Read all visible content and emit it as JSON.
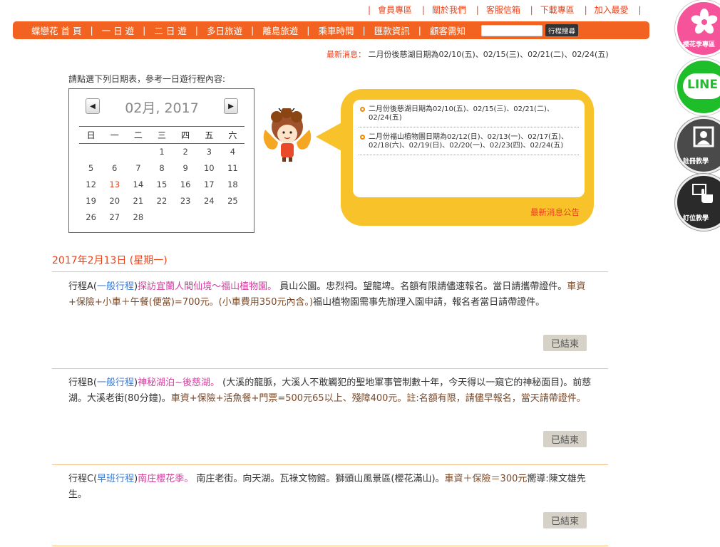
{
  "toplinks": [
    "會員專區",
    "關於我們",
    "客服信箱",
    "下載專區",
    "加入最愛"
  ],
  "nav": {
    "items": [
      "蝶戀花 首 頁",
      "一 日 遊",
      "二 日 遊",
      "多日旅遊",
      "離島旅遊",
      "乘車時間",
      "匯款資訊",
      "顧客需知"
    ],
    "search_button": "行程搜尋"
  },
  "news_line": {
    "label": "最新消息：",
    "text": "二月份後慈湖日期為02/10(五)、02/15(三)、02/21(二)、02/24(五)"
  },
  "instruction": "請點選下列日期表，參考一日遊行程內容:",
  "calendar": {
    "title": "02月, 2017",
    "prev": "◀",
    "next": "▶",
    "weekdays": [
      "日",
      "一",
      "二",
      "三",
      "四",
      "五",
      "六"
    ],
    "weeks": [
      [
        "",
        "",
        "",
        "1",
        "2",
        "3",
        "4"
      ],
      [
        "5",
        "6",
        "7",
        "8",
        "9",
        "10",
        "11"
      ],
      [
        "12",
        "13",
        "14",
        "15",
        "16",
        "17",
        "18"
      ],
      [
        "19",
        "20",
        "21",
        "22",
        "23",
        "24",
        "25"
      ],
      [
        "26",
        "27",
        "28",
        "",
        "",
        "",
        ""
      ]
    ],
    "highlight": "13"
  },
  "bubble": {
    "items": [
      "二月份後慈湖日期為02/10(五)、02/15(三)、02/21(二)、02/24(五)",
      "二月份福山植物園日期為02/12(日)、02/13(一)、02/17(五)、02/18(六)、02/19(日)、02/20(一)、02/23(四)、02/24(五)"
    ],
    "more": "最新消息公告"
  },
  "date_heading": "2017年2月13日 (星期一)",
  "trips": [
    {
      "prefix": "行程A(",
      "category": "一般行程",
      "mid": ")",
      "title": "探訪宜蘭人間仙境～福山植物園。",
      "desc": " 員山公園。忠烈祠。望龍埤。名額有限請儘速報名。當日請攜帶證件。",
      "price": "車資+保險+小車＋午餐(便當)=700元。(小車費用350元內含。)",
      "note": "福山植物園需事先辦理入園申請，報名者當日請帶證件。",
      "status": "已結束"
    },
    {
      "prefix": "行程B(",
      "category": "一般行程",
      "mid": ")",
      "title": "神秘湖泊~後慈湖。",
      "desc": " (大溪的龍脈，大溪人不敢觸犯的聖地軍事管制數十年，今天得以一窺它的神秘面目)。前慈湖。大溪老街(80分鐘)。",
      "price": "車資+保險+活魚餐+門票=500元65以上、殘障400元。註:名額有限，請儘早報名，當天請帶證件。",
      "note": "",
      "status": "已結束"
    },
    {
      "prefix": "行程C(",
      "category": "早班行程",
      "mid": ")",
      "title": "南庄櫻花季。",
      "desc": " 南庄老街。向天湖。瓦祿文物館。獅頭山風景區(櫻花滿山)。",
      "price": "車資＋保險＝300元",
      "note": "嚮導:陳文雄先生。",
      "status": "已結束"
    }
  ],
  "side": {
    "sakura": "櫻花季專區",
    "line": "LINE",
    "register": "註冊教學",
    "booking": "訂位教學"
  }
}
